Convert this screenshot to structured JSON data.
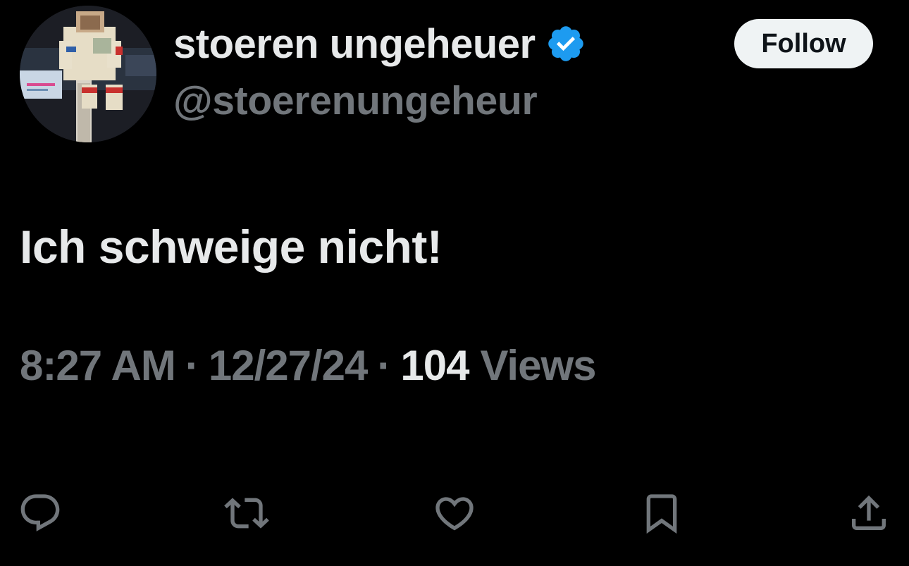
{
  "author": {
    "display_name": "stoeren ungeheuer",
    "handle": "@stoerenungeheur",
    "verified": true,
    "verified_color": "#1d9bf0",
    "avatar": "lego-figure-avatar"
  },
  "header": {
    "follow_label": "Follow"
  },
  "tweet": {
    "text": "Ich schweige nicht!",
    "time": "8:27 AM",
    "separator": "·",
    "date": "12/27/24",
    "views_count": "104",
    "views_label": "Views"
  },
  "actions": [
    {
      "name": "reply",
      "icon": "reply-icon"
    },
    {
      "name": "retweet",
      "icon": "retweet-icon"
    },
    {
      "name": "like",
      "icon": "heart-icon"
    },
    {
      "name": "bookmark",
      "icon": "bookmark-icon"
    },
    {
      "name": "share",
      "icon": "share-icon"
    }
  ],
  "colors": {
    "background": "#000000",
    "primary_text": "#e7e9ea",
    "secondary_text": "#71767b",
    "follow_bg": "#eff3f4",
    "follow_text": "#0f1419"
  }
}
